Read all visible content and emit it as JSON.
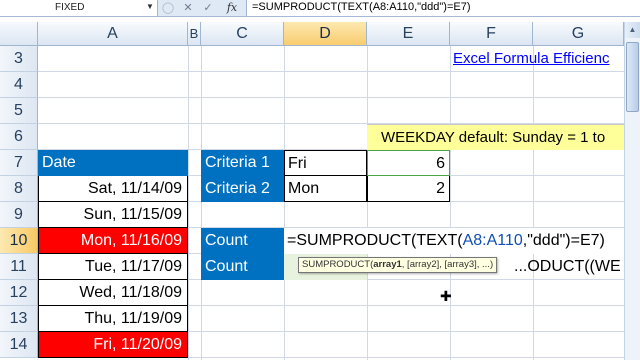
{
  "formula_bar": {
    "name_box": "FIXED",
    "cancel_icon": "✕",
    "enter_icon": "✓",
    "fx_label": "fx",
    "formula": "=SUMPRODUCT(TEXT(A8:A110,\"ddd\")=E7)"
  },
  "columns": [
    "A",
    "B",
    "C",
    "D",
    "E",
    "F",
    "G"
  ],
  "rows": [
    "3",
    "4",
    "5",
    "6",
    "7",
    "8",
    "9",
    "10",
    "11",
    "12",
    "13",
    "14"
  ],
  "cells": {
    "link": "Excel Formula Efficienc",
    "weekday_note": "WEEKDAY default: Sunday = 1 to",
    "date_header": "Date",
    "dates": [
      {
        "text": "Sat, 11/14/09",
        "highlight": false
      },
      {
        "text": "Sun, 11/15/09",
        "highlight": false
      },
      {
        "text": "Mon, 11/16/09",
        "highlight": true
      },
      {
        "text": "Tue, 11/17/09",
        "highlight": false
      },
      {
        "text": "Wed, 11/18/09",
        "highlight": false
      },
      {
        "text": "Thu, 11/19/09",
        "highlight": false
      },
      {
        "text": "Fri, 11/20/09",
        "highlight": true
      }
    ],
    "criteria1_label": "Criteria 1",
    "criteria1_value": "Fri",
    "criteria1_count": "6",
    "criteria2_label": "Criteria 2",
    "criteria2_value": "Mon",
    "criteria2_count": "2",
    "count_label_1": "Count",
    "count_label_2": "Count",
    "edit_prefix": "=SUMPRODUCT(TEXT(",
    "edit_range": "A8:A110",
    "edit_suffix": ",\"ddd\")=E7)",
    "behind_text": "...ODUCT((WE"
  },
  "tooltip": {
    "fn": "SUMPRODUCT(",
    "arg1": "array1",
    "rest": ", [array2], [array3], ...)"
  },
  "colors": {
    "header_blue": "#0070c0",
    "highlight_red": "#ff0000",
    "note_yellow": "#ffff99",
    "active_header": "#f9cc6f"
  }
}
